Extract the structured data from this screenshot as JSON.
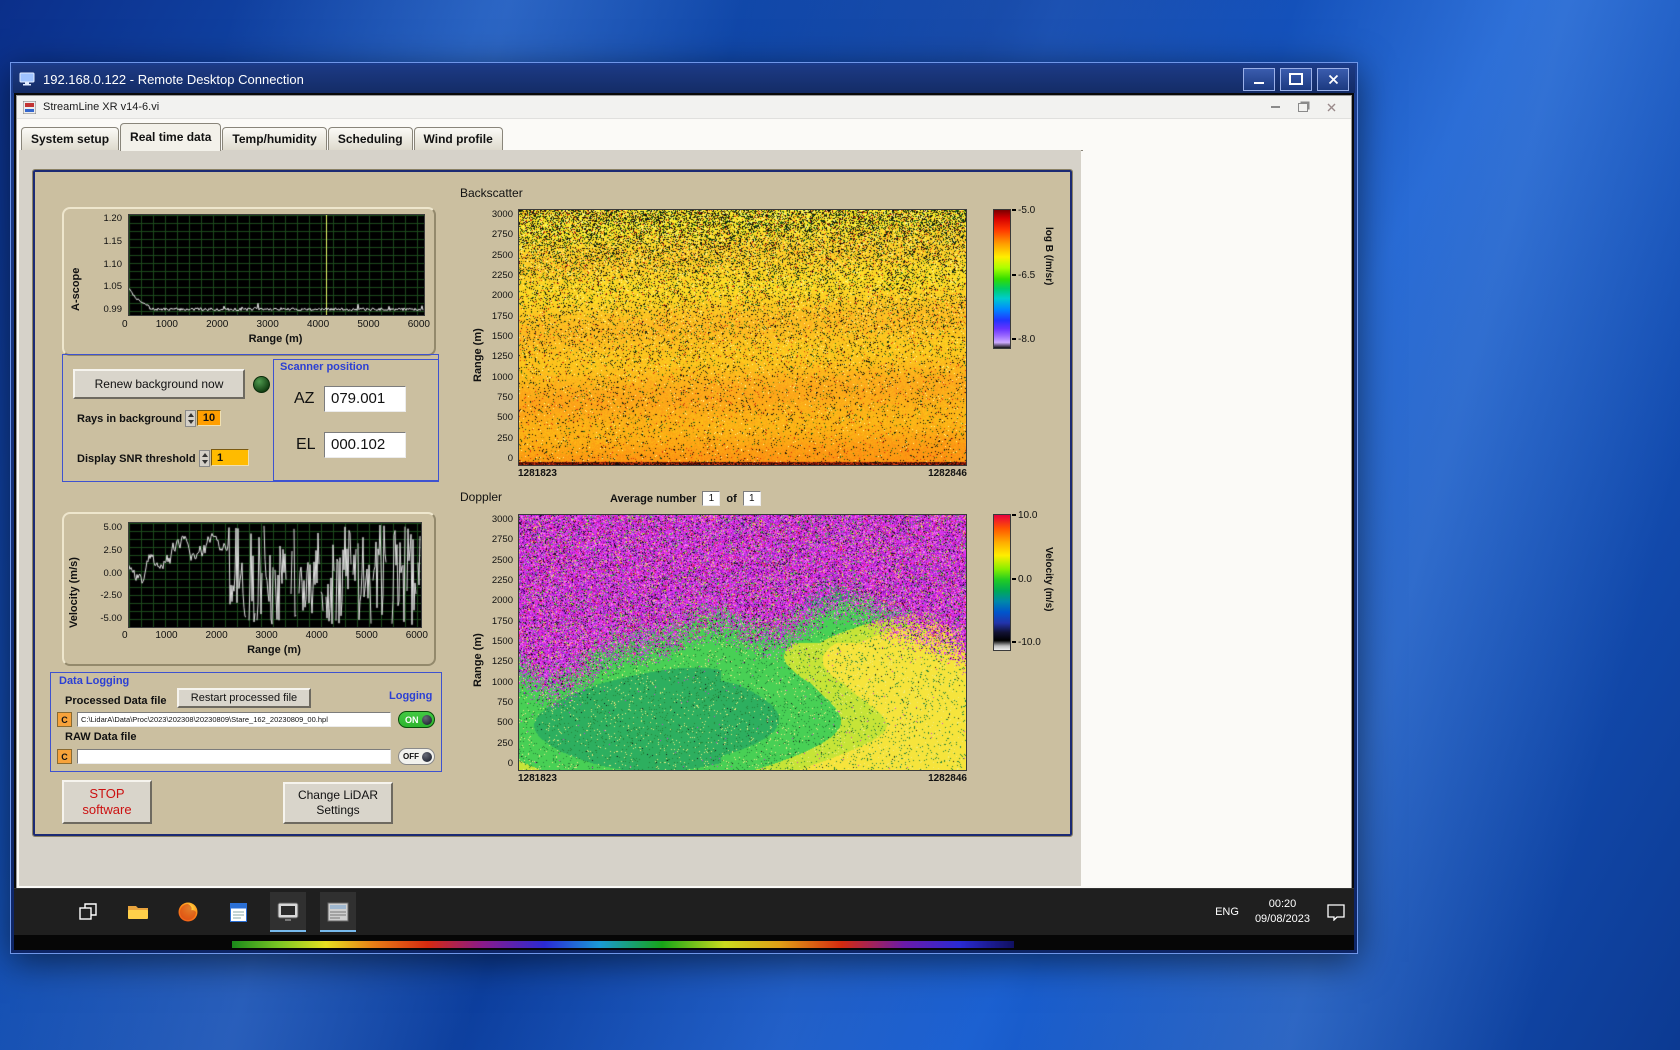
{
  "colors": {
    "panel_tan": "#cbbfa0",
    "group_border": "#3e52d0",
    "blue_label": "#2b3fd4",
    "field_orange": "#ff9e00",
    "field_amber": "#ffbb00",
    "toggle_on_green": "#2db52d",
    "stop_red": "#cc1111",
    "titlebar_navy": "#1c3a85",
    "taskbar_dark": "#1f1f1f"
  },
  "rdp": {
    "title": "192.168.0.122 - Remote Desktop Connection"
  },
  "app": {
    "title": "StreamLine XR v14-6.vi",
    "tabs": [
      {
        "label": "System setup"
      },
      {
        "label": "Real time data"
      },
      {
        "label": "Temp/humidity"
      },
      {
        "label": "Scheduling"
      },
      {
        "label": "Wind profile"
      }
    ],
    "active_tab": "Real time data"
  },
  "ascope": {
    "ylabel": "A-scope",
    "xlabel": "Range (m)",
    "yticks": [
      "1.20",
      "1.15",
      "1.10",
      "1.05",
      "0.99"
    ],
    "xticks": [
      "0",
      "1000",
      "2000",
      "3000",
      "4000",
      "5000",
      "6000"
    ]
  },
  "background_controls": {
    "renew_button": "Renew background now",
    "rays_label": "Rays in background",
    "rays_value": "10",
    "snr_label": "Display SNR threshold",
    "snr_value": "1"
  },
  "scanner_position": {
    "title": "Scanner position",
    "az_label": "AZ",
    "az_value": "079.001",
    "el_label": "EL",
    "el_value": "000.102"
  },
  "backscatter": {
    "title": "Backscatter",
    "ylabel": "Range (m)",
    "yticks": [
      "3000",
      "2750",
      "2500",
      "2250",
      "2000",
      "1750",
      "1500",
      "1250",
      "1000",
      "750",
      "500",
      "250",
      "0"
    ],
    "xstart": "1281823",
    "xend": "1282846",
    "colorbar": {
      "label": "log B (/m/sr)",
      "ticks": [
        "-5.0",
        "-6.5",
        "-8.0"
      ]
    }
  },
  "doppler": {
    "title": "Doppler",
    "average_label": "Average number",
    "average_value": "1",
    "of_label": "of",
    "of_value": "1",
    "ylabel": "Range (m)",
    "yticks": [
      "3000",
      "2750",
      "2500",
      "2250",
      "2000",
      "1750",
      "1500",
      "1250",
      "1000",
      "750",
      "500",
      "250",
      "0"
    ],
    "xstart": "1281823",
    "xend": "1282846",
    "colorbar": {
      "label": "Velocity (m/s)",
      "ticks": [
        "10.0",
        "0.0",
        "-10.0"
      ]
    }
  },
  "velocity": {
    "ylabel": "Velocity (m/s)",
    "xlabel": "Range (m)",
    "yticks": [
      "5.00",
      "2.50",
      "0.00",
      "-2.50",
      "-5.00"
    ],
    "xticks": [
      "0",
      "1000",
      "2000",
      "3000",
      "4000",
      "5000",
      "6000"
    ]
  },
  "data_logging": {
    "title": "Data Logging",
    "processed_label": "Processed Data file",
    "restart_button": "Restart processed file",
    "logging_label": "Logging",
    "drive": "C",
    "processed_path": "C:\\LidarA\\Data\\Proc\\2023\\202308\\20230809\\Stare_162_20230809_00.hpl",
    "processed_toggle": "ON",
    "raw_label": "RAW Data file",
    "raw_path": "",
    "raw_toggle": "OFF"
  },
  "actions": {
    "stop_line1": "STOP",
    "stop_line2": "software",
    "settings_line1": "Change LiDAR",
    "settings_line2": "Settings"
  },
  "taskbar": {
    "language": "ENG",
    "time": "00:20",
    "date": "09/08/2023",
    "icons": [
      "task-view",
      "file-explorer",
      "firefox",
      "document-app",
      "streamline-app",
      "scan-scheduler"
    ]
  }
}
